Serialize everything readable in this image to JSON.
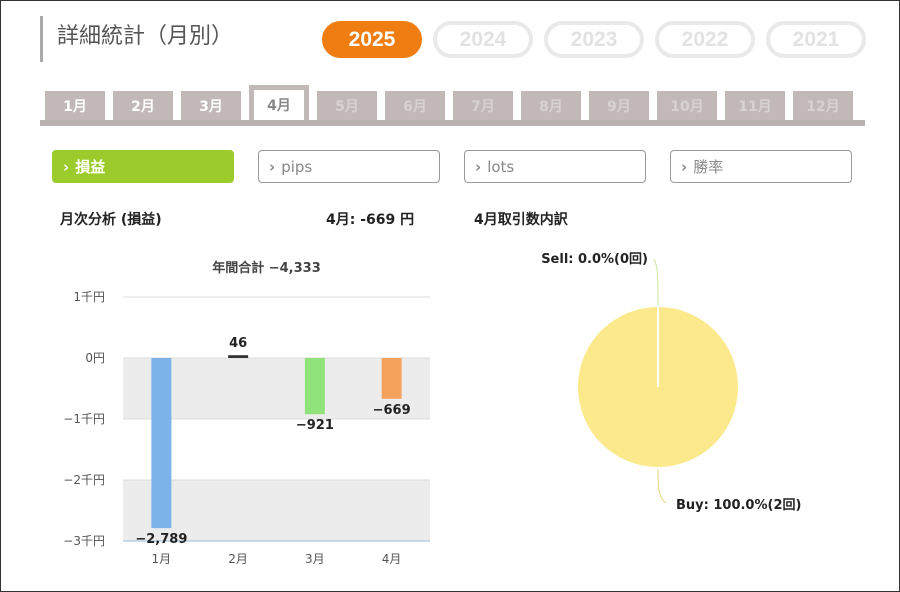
{
  "page": {
    "title": "詳細統計（月別）",
    "years": [
      {
        "label": "2025",
        "active": true
      },
      {
        "label": "2024",
        "active": false
      },
      {
        "label": "2023",
        "active": false
      },
      {
        "label": "2022",
        "active": false
      },
      {
        "label": "2021",
        "active": false
      }
    ],
    "months": [
      {
        "label": "1月",
        "state": "on"
      },
      {
        "label": "2月",
        "state": "on"
      },
      {
        "label": "3月",
        "state": "on"
      },
      {
        "label": "4月",
        "state": "active"
      },
      {
        "label": "5月",
        "state": "dim"
      },
      {
        "label": "6月",
        "state": "dim"
      },
      {
        "label": "7月",
        "state": "dim"
      },
      {
        "label": "8月",
        "state": "dim"
      },
      {
        "label": "9月",
        "state": "dim"
      },
      {
        "label": "10月",
        "state": "dim"
      },
      {
        "label": "11月",
        "state": "dim"
      },
      {
        "label": "12月",
        "state": "dim"
      }
    ],
    "metrics": [
      {
        "label": "損益",
        "active": true
      },
      {
        "label": "pips",
        "active": false
      },
      {
        "label": "lots",
        "active": false
      },
      {
        "label": "勝率",
        "active": false
      }
    ],
    "monthly_heading": "月次分析 (損益)",
    "month_summary": "4月:  -669 円",
    "breakdown_heading": "4月取引数内訳"
  },
  "colors": {
    "accent": "#f07d12",
    "metric_active": "#9ccb2c",
    "bar_colors": [
      "#7db3e8",
      "#333333",
      "#90e37a",
      "#f5a35c"
    ],
    "pie_buy": "#fbe98b",
    "pie_line": "#c8e6a0"
  },
  "chart_data": [
    {
      "type": "bar",
      "title": "年間合計 −4,333",
      "categories": [
        "1月",
        "2月",
        "3月",
        "4月"
      ],
      "values": [
        -2789,
        46,
        -921,
        -669
      ],
      "data_labels": [
        "−2,789",
        "46",
        "−921",
        "−669"
      ],
      "ytick_values": [
        1000,
        0,
        -1000,
        -2000,
        -3000
      ],
      "ytick_labels": [
        "1千円",
        "0円",
        "−1千円",
        "−2千円",
        "−3千円"
      ],
      "ylim": [
        -3000,
        1000
      ],
      "grid": true
    },
    {
      "type": "pie",
      "slices": [
        {
          "label": "Sell: 0.0%(0回)",
          "value": 0
        },
        {
          "label": "Buy: 100.0%(2回)",
          "value": 100
        }
      ]
    }
  ]
}
